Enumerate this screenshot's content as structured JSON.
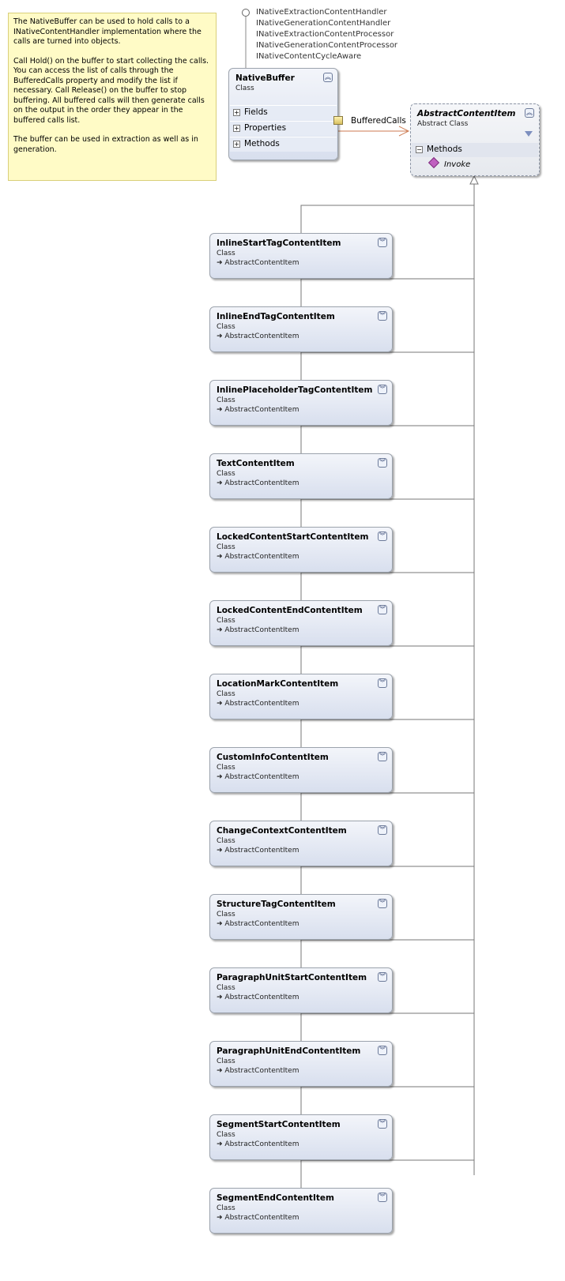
{
  "note": {
    "paragraphs": [
      "The NativeBuffer can be used to hold calls to a INativeContentHandler implementation where the calls are turned into objects.",
      "Call Hold() on the buffer to start collecting the calls. You can access the list of calls through the BufferedCalls property and modify the list if necessary. Call Release() on the buffer to stop buffering. All buffered calls will then generate calls on the output in the order they appear in the buffered calls list.",
      "The buffer can be used in extraction as well as in generation."
    ]
  },
  "interfaces": [
    "INativeExtractionContentHandler",
    "INativeGenerationContentHandler",
    "INativeExtractionContentProcessor",
    "INativeGenerationContentProcessor",
    "INativeContentCycleAware"
  ],
  "native_buffer": {
    "name": "NativeBuffer",
    "kind": "Class",
    "sections": [
      "Fields",
      "Properties",
      "Methods"
    ]
  },
  "association": {
    "label": "BufferedCalls"
  },
  "abstract_item": {
    "name": "AbstractContentItem",
    "kind": "Abstract Class",
    "section": "Methods",
    "member": "Invoke"
  },
  "derived_classes": [
    {
      "name": "InlineStartTagContentItem",
      "kind": "Class",
      "base": "AbstractContentItem"
    },
    {
      "name": "InlineEndTagContentItem",
      "kind": "Class",
      "base": "AbstractContentItem"
    },
    {
      "name": "InlinePlaceholderTagContentItem",
      "kind": "Class",
      "base": "AbstractContentItem"
    },
    {
      "name": "TextContentItem",
      "kind": "Class",
      "base": "AbstractContentItem"
    },
    {
      "name": "LockedContentStartContentItem",
      "kind": "Class",
      "base": "AbstractContentItem"
    },
    {
      "name": "LockedContentEndContentItem",
      "kind": "Class",
      "base": "AbstractContentItem"
    },
    {
      "name": "LocationMarkContentItem",
      "kind": "Class",
      "base": "AbstractContentItem"
    },
    {
      "name": "CustomInfoContentItem",
      "kind": "Class",
      "base": "AbstractContentItem"
    },
    {
      "name": "ChangeContextContentItem",
      "kind": "Class",
      "base": "AbstractContentItem"
    },
    {
      "name": "StructureTagContentItem",
      "kind": "Class",
      "base": "AbstractContentItem"
    },
    {
      "name": "ParagraphUnitStartContentItem",
      "kind": "Class",
      "base": "AbstractContentItem"
    },
    {
      "name": "ParagraphUnitEndContentItem",
      "kind": "Class",
      "base": "AbstractContentItem"
    },
    {
      "name": "SegmentStartContentItem",
      "kind": "Class",
      "base": "AbstractContentItem"
    },
    {
      "name": "SegmentEndContentItem",
      "kind": "Class",
      "base": "AbstractContentItem"
    }
  ]
}
